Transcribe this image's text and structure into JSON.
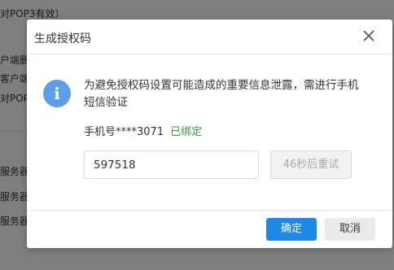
{
  "background": {
    "lines": [
      "对POP3有效）",
      "户端删",
      "客户端",
      "对POP",
      "服务器",
      "服务器",
      "服务器"
    ]
  },
  "dialog": {
    "title": "生成授权码",
    "close_icon": "close-icon",
    "info_icon": "info-icon",
    "info_glyph": "i",
    "warning": "为避免授权码设置可能造成的重要信息泄露，需进行手机短信验证",
    "phone_label": "手机号****3071",
    "bound_status": "已绑定",
    "code_value": "597518",
    "retry_label": "46秒后重试",
    "confirm_label": "确定",
    "cancel_label": "取消"
  },
  "colors": {
    "accent": "#1e88e5",
    "info": "#5b9fe6",
    "bound": "#2ea232"
  }
}
